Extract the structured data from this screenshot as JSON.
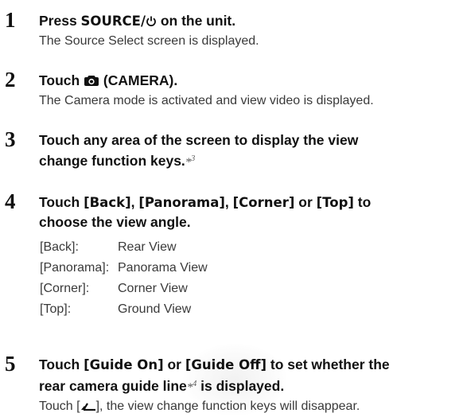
{
  "steps": [
    {
      "number": "1",
      "heading_pre": "Press ",
      "heading_kw": "SOURCE/",
      "heading_post": " on the unit.",
      "icon": "power-icon",
      "description": "The Source Select screen is displayed."
    },
    {
      "number": "2",
      "heading_pre": "Touch ",
      "heading_post": " (CAMERA).",
      "icon": "camera-icon",
      "description": "The Camera mode is activated and view video is displayed."
    },
    {
      "number": "3",
      "heading_line1": "Touch any area of the screen to display the view",
      "heading_line2": "change function keys.",
      "note_mark": "*",
      "note_num": "3"
    },
    {
      "number": "4",
      "heading_pre": "Touch ",
      "kw1": "[Back]",
      "sep1": ", ",
      "kw2": "[Panorama]",
      "sep2": ", ",
      "kw3": "[Corner]",
      "sep3": " or ",
      "kw4": "[Top]",
      "heading_post": " to",
      "heading_line2": "choose the view angle.",
      "views": [
        {
          "key": "[Back]:",
          "value": "Rear View"
        },
        {
          "key": "[Panorama]:",
          "value": "Panorama View"
        },
        {
          "key": "[Corner]:",
          "value": "Corner View"
        },
        {
          "key": "[Top]:",
          "value": "Ground View"
        }
      ]
    },
    {
      "number": "5",
      "heading_pre": "Touch ",
      "kw1": "[Guide On]",
      "sep1": " or ",
      "kw2": "[Guide Off]",
      "heading_post": " to set whether the",
      "heading_line2_pre": "rear camera guide line",
      "note_mark": "*",
      "note_num": "4",
      "heading_line2_post": " is displayed.",
      "desc_pre": "Touch [",
      "icon": "back-arrow-icon",
      "desc_post": "], the view change function keys will disappear."
    }
  ]
}
